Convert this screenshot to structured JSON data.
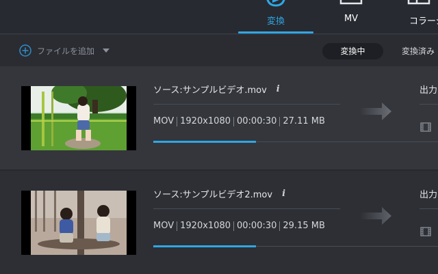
{
  "nav": {
    "tabs": [
      {
        "label": "変換",
        "icon": "convert-icon",
        "active": true
      },
      {
        "label": "MV",
        "icon": "mv-icon",
        "active": false
      },
      {
        "label": "コラージ",
        "icon": "collage-icon",
        "active": false
      }
    ]
  },
  "toolbar": {
    "add_label": "ファイルを追加",
    "converting_label": "変換中",
    "converted_label": "変換済み"
  },
  "files": [
    {
      "source": "ソース:サンプルビデオ.mov",
      "format": "MOV",
      "resolution": "1920x1080",
      "duration": "00:00:30",
      "size": "27.11 MB",
      "output_label": "出力",
      "progress": 0.36
    },
    {
      "source": "ソース:サンプルビデオ2.mov",
      "format": "MOV",
      "resolution": "1920x1080",
      "duration": "00:00:30",
      "size": "29.15 MB",
      "output_label": "出力",
      "progress": 0.36
    }
  ],
  "colors": {
    "accent": "#2fa7e6",
    "background": "#2f3137",
    "nav_background": "#272a31"
  }
}
